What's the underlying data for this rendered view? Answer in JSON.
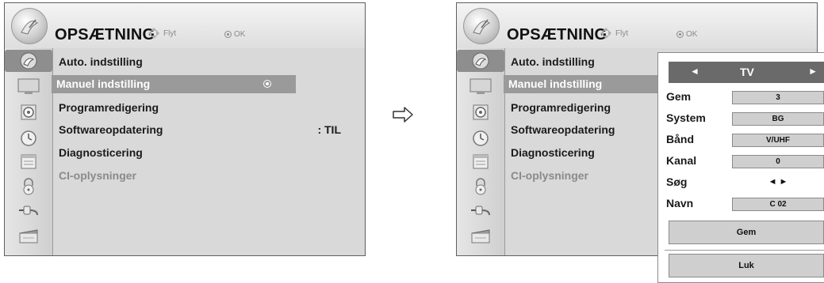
{
  "left_menu": {
    "title": "OPSÆTNING",
    "hint_move": "Flyt",
    "hint_ok": "OK",
    "items": [
      {
        "label": "Auto. indstilling"
      },
      {
        "label": "Manuel indstilling"
      },
      {
        "label": "Programredigering"
      },
      {
        "label": "Softwareopdatering",
        "value": ": TIL"
      },
      {
        "label": "Diagnosticering"
      },
      {
        "label": "CI-oplysninger"
      }
    ],
    "sidebar_icons": [
      "satellite-dish-icon",
      "tv-screen-icon",
      "speaker-icon",
      "clock-icon",
      "calendar-icon",
      "lock-icon",
      "plug-icon",
      "clapperboard-icon"
    ]
  },
  "right_menu": {
    "title": "OPSÆTNING",
    "hint_move": "Flyt",
    "hint_ok": "OK",
    "items": [
      {
        "label": "Auto. indstilling"
      },
      {
        "label": "Manuel indstilling"
      },
      {
        "label": "Programredigering"
      },
      {
        "label": "Softwareopdatering"
      },
      {
        "label": "Diagnosticering"
      },
      {
        "label": "CI-oplysninger"
      }
    ]
  },
  "manual_panel": {
    "source": "TV",
    "rows": [
      {
        "label": "Gem",
        "value": "3"
      },
      {
        "label": "System",
        "value": "BG"
      },
      {
        "label": "Bånd",
        "value": "V/UHF"
      },
      {
        "label": "Kanal",
        "value": "0"
      },
      {
        "label": "Søg",
        "value": "◄ ►"
      },
      {
        "label": "Navn",
        "value": "C 02"
      }
    ],
    "save_button": "Gem",
    "close_button": "Luk"
  },
  "colors": {
    "highlight": "#9a9a9a",
    "panel_bar": "#6a6a6a"
  }
}
